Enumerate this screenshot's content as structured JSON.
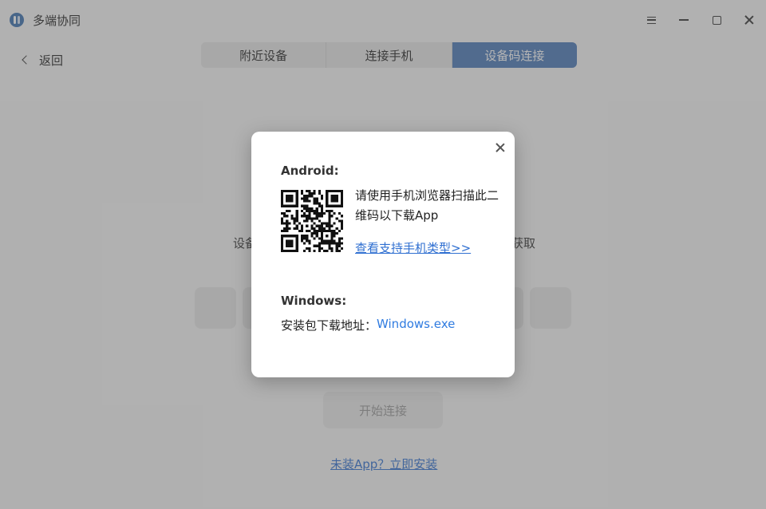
{
  "window": {
    "title": "多端协同",
    "menu_icon": "hamburger-icon",
    "minimize_icon": "minimize-icon",
    "maximize_icon": "maximize-icon",
    "close_icon": "close-icon"
  },
  "nav": {
    "back_label": "返回"
  },
  "tabs": [
    {
      "label": "附近设备",
      "active": false
    },
    {
      "label": "连接手机",
      "active": false
    },
    {
      "label": "设备码连接",
      "active": true
    }
  ],
  "background": {
    "prompt_left": "设备",
    "prompt_right": "获取",
    "code_boxes": 6,
    "start_button": "开始连接",
    "install_link": "未装App？立即安装"
  },
  "dialog": {
    "android_title": "Android:",
    "qr_description": "请使用手机浏览器扫描此二维码以下载App",
    "support_link": "查看支持手机类型>>",
    "windows_title": "Windows:",
    "download_label": "安装包下载地址：",
    "download_link": "Windows.exe"
  },
  "colors": {
    "accent": "#4a78b8",
    "link": "#2f6fd1"
  }
}
